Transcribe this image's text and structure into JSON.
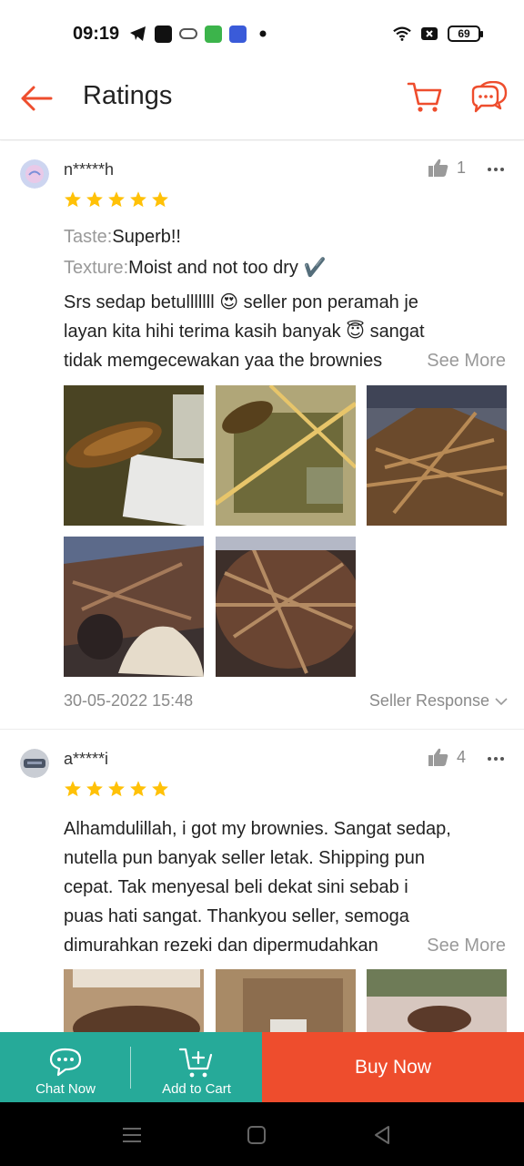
{
  "status_bar": {
    "time": "09:19",
    "battery": "69"
  },
  "header": {
    "title": "Ratings"
  },
  "colors": {
    "brand": "#ee4d2d",
    "star": "#ffc107",
    "green": "#26aa99"
  },
  "reviews": [
    {
      "username": "n*****h",
      "rating": 5,
      "likes": "1",
      "attributes": [
        {
          "label": "Taste:",
          "value": "Superb!!"
        },
        {
          "label": "Texture:",
          "value": "Moist and not too dry ✔️"
        }
      ],
      "text_lines": [
        "Srs sedap betulllllll 😍 seller pon peramah je",
        "layan kita hihi terima kasih banyak 😇 sangat",
        "tidak memgecewakan yaa the brownies"
      ],
      "see_more": "See More",
      "photo_count": 5,
      "timestamp": "30-05-2022 15:48",
      "seller_response": "Seller Response"
    },
    {
      "username": "a*****i",
      "rating": 5,
      "likes": "4",
      "text_lines": [
        "Alhamdulillah, i got my brownies. Sangat sedap,",
        "nutella pun banyak seller letak. Shipping pun",
        "cepat. Tak menyesal beli dekat sini sebab i",
        "puas hati sangat. Thankyou seller, semoga",
        "dimurahkan rezeki dan dipermudahkan"
      ],
      "see_more": "See More",
      "photo_count": 3
    }
  ],
  "action_bar": {
    "chat_label": "Chat Now",
    "cart_label": "Add to Cart",
    "buy_label": "Buy Now"
  },
  "icons": [
    "back-arrow-icon",
    "cart-icon",
    "chat-icon",
    "thumbs-up-icon",
    "more-icon",
    "star-icon",
    "chevron-down-icon",
    "menu-icon",
    "home-icon",
    "back-icon"
  ]
}
